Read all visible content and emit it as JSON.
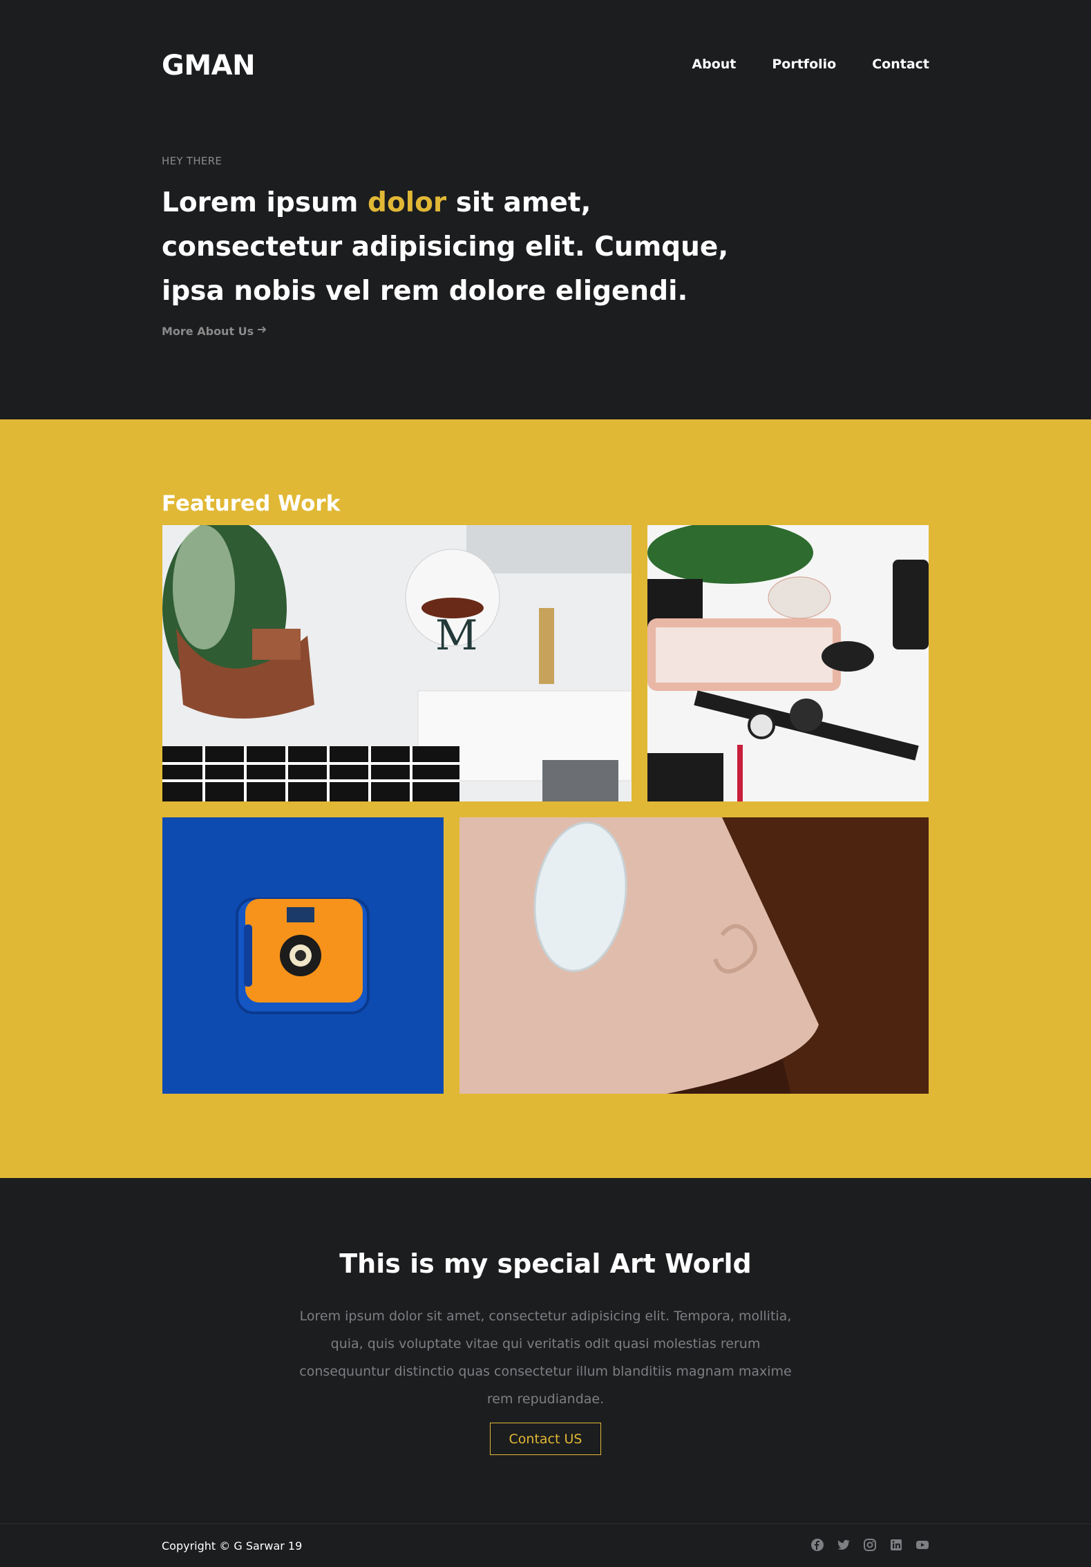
{
  "header": {
    "brand": "GMAN",
    "nav": [
      "About",
      "Portfolio",
      "Contact"
    ],
    "eyebrow": "HEY THERE",
    "headline_before": "Lorem ipsum ",
    "headline_highlight": "dolor",
    "headline_after": " sit amet, consectetur adipisicing elit. Cumque, ipsa nobis vel rem dolore eligendi.",
    "more_link": "More About Us"
  },
  "featured": {
    "title": "Featured Work",
    "items": [
      {
        "icon": "desk-plant-mug-keyboard-photo"
      },
      {
        "icon": "keyboard-watches-flatlay-photo"
      },
      {
        "icon": "orange-camera-on-blue-photo"
      },
      {
        "icon": "mouse-on-leather-pad-photo"
      }
    ]
  },
  "about": {
    "title": "This is my special Art World",
    "text": "Lorem ipsum dolor sit amet, consectetur adipisicing elit. Tempora, mollitia, quia, quis voluptate vitae qui veritatis odit quasi molestias rerum consequuntur distinctio quas consectetur illum blanditiis magnam maxime rem repudiandae.",
    "button": "Contact US"
  },
  "footer": {
    "copyright": "Copyright © G Sarwar 19",
    "socials": [
      "facebook-icon",
      "twitter-icon",
      "instagram-icon",
      "linkedin-icon",
      "youtube-icon"
    ]
  },
  "colors": {
    "background": "#1c1d1f",
    "accent": "#e1b835",
    "muted_text": "#7d7f82"
  }
}
